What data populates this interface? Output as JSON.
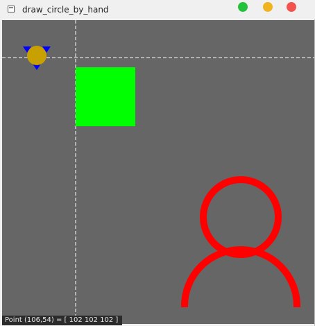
{
  "window": {
    "title": "draw_circle_by_hand",
    "buttons": [
      {
        "name": "minimize",
        "color": "#22c33a"
      },
      {
        "name": "maximize",
        "color": "#f0b41c"
      },
      {
        "name": "close",
        "color": "#f4534d"
      }
    ]
  },
  "canvas": {
    "background": "#666666",
    "crosshair_color": "#ffffff",
    "shapes": {
      "green_square": {
        "color": "#00ff00"
      },
      "marker_circle": {
        "color": "#c8a000"
      },
      "marker_triangles": {
        "color": "#0000ff"
      },
      "person_icon": {
        "color": "#ff0000"
      }
    }
  },
  "statusbar": {
    "text": "Point  (106,54) = [  102  102  102  ]"
  }
}
